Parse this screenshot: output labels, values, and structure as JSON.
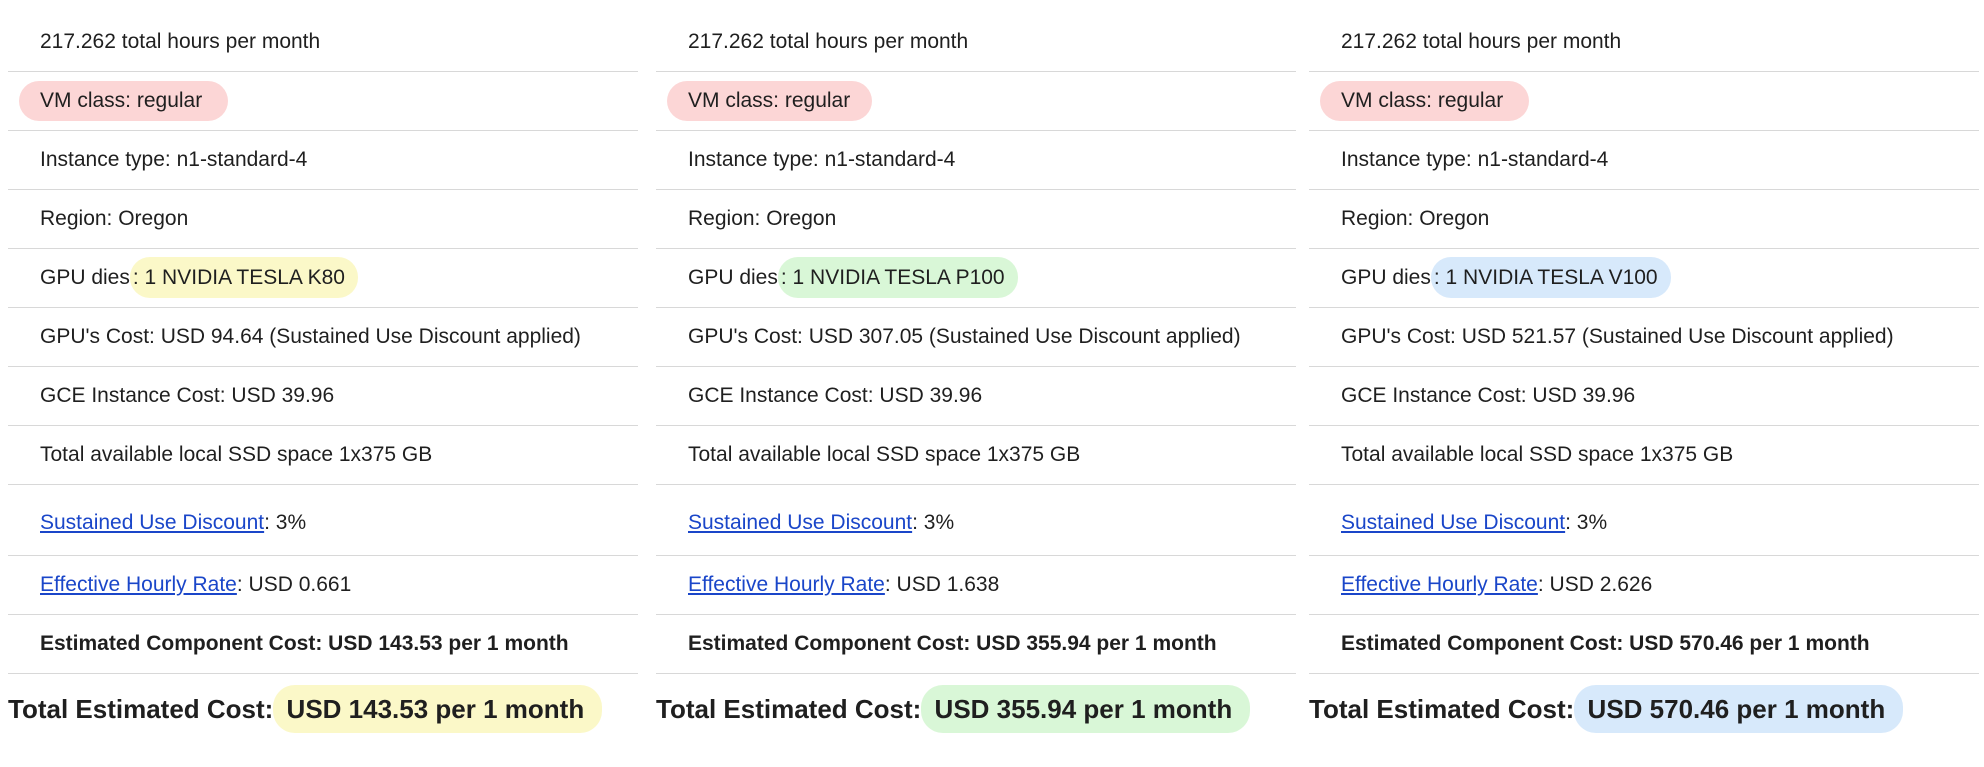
{
  "columns": [
    {
      "hours": "217.262 total hours per month",
      "vm_class": "VM class: regular",
      "instance_type": "Instance type: n1-standard-4",
      "region": "Region: Oregon",
      "gpu_prefix": "GPU dies",
      "gpu_value": ": 1 NVIDIA TESLA K80",
      "gpu_cost": "GPU's Cost: USD 94.64 (Sustained Use Discount applied)",
      "gce_cost": "GCE Instance Cost: USD 39.96",
      "ssd": "Total available local SSD space 1x375 GB",
      "sud_link": "Sustained Use Discount",
      "sud_value": ": 3%",
      "ehr_link": "Effective Hourly Rate",
      "ehr_value": ": USD 0.661",
      "component_cost": "Estimated Component Cost: USD 143.53 per 1 month",
      "total_label": "Total Estimated Cost:",
      "total_value": " USD 143.53 per 1 month",
      "highlight_color": "#fbf8c8"
    },
    {
      "hours": "217.262 total hours per month",
      "vm_class": "VM class: regular",
      "instance_type": "Instance type: n1-standard-4",
      "region": "Region: Oregon",
      "gpu_prefix": "GPU dies",
      "gpu_value": ": 1 NVIDIA TESLA P100",
      "gpu_cost": "GPU's Cost: USD 307.05 (Sustained Use Discount applied)",
      "gce_cost": "GCE Instance Cost: USD 39.96",
      "ssd": "Total available local SSD space 1x375 GB",
      "sud_link": "Sustained Use Discount",
      "sud_value": ": 3%",
      "ehr_link": "Effective Hourly Rate",
      "ehr_value": ": USD 1.638",
      "component_cost": "Estimated Component Cost: USD 355.94 per 1 month",
      "total_label": "Total Estimated Cost:",
      "total_value": " USD 355.94 per 1 month",
      "highlight_color": "#d9f7d7"
    },
    {
      "hours": "217.262 total hours per month",
      "vm_class": "VM class: regular",
      "instance_type": "Instance type: n1-standard-4",
      "region": "Region: Oregon",
      "gpu_prefix": "GPU dies",
      "gpu_value": ": 1 NVIDIA TESLA V100",
      "gpu_cost": "GPU's Cost: USD 521.57 (Sustained Use Discount applied)",
      "gce_cost": "GCE Instance Cost: USD 39.96",
      "ssd": "Total available local SSD space 1x375 GB",
      "sud_link": "Sustained Use Discount",
      "sud_value": ": 3%",
      "ehr_link": "Effective Hourly Rate",
      "ehr_value": ": USD 2.626",
      "component_cost": "Estimated Component Cost: USD 570.46 per 1 month",
      "total_label": "Total Estimated Cost:",
      "total_value": " USD 570.46 per 1 month",
      "highlight_color": "#d7e9fb"
    }
  ],
  "colors": {
    "vm_class_pill": "#fcd6d6",
    "link": "#1a46c9",
    "divider": "#d8d8d8"
  }
}
